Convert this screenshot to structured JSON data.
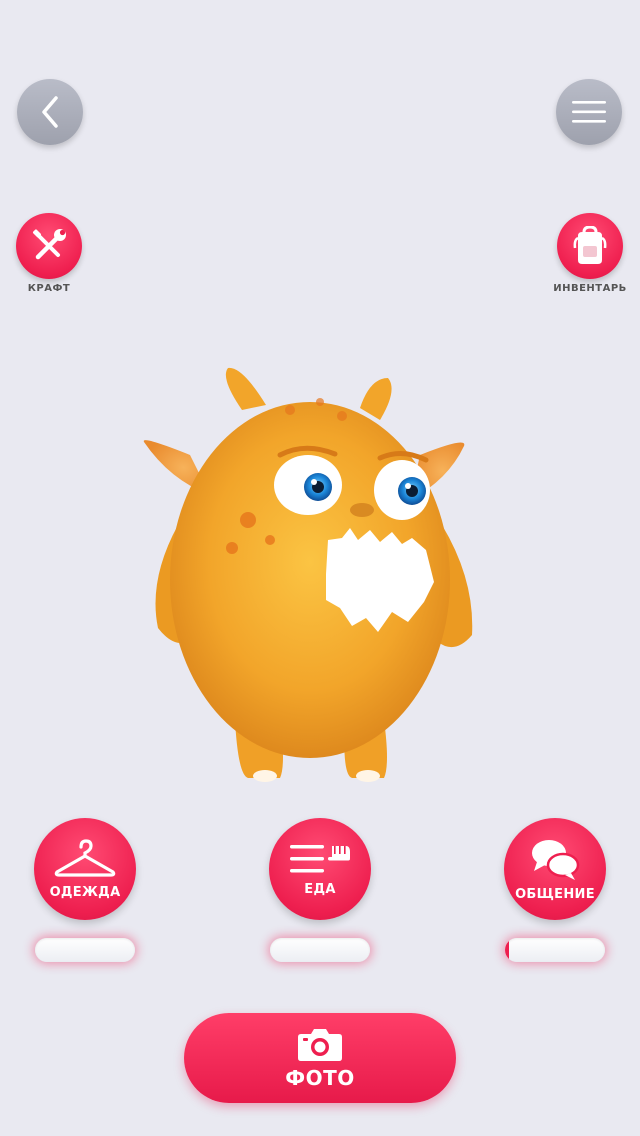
{
  "nav": {
    "back_icon": "chevron-left-icon",
    "menu_icon": "hamburger-menu-icon"
  },
  "side_actions": {
    "craft": {
      "label": "КРАФТ",
      "icon": "wrench-screwdriver-icon"
    },
    "inventory": {
      "label": "ИНВЕНТАРЬ",
      "icon": "backpack-icon"
    }
  },
  "needs": [
    {
      "label": "ОДЕЖДА",
      "icon": "hanger-icon",
      "level": 0
    },
    {
      "label": "ЕДА",
      "icon": "fork-icon",
      "level": 0
    },
    {
      "label": "ОБЩЕНИЕ",
      "icon": "chat-bubbles-icon",
      "level": 0.04
    }
  ],
  "photo_button": {
    "label": "ФОТО",
    "icon": "camera-icon"
  },
  "colors": {
    "accent": "#ee1f4f",
    "background": "#e9e9f1",
    "nav_button": "#a9acb8",
    "monster_body": "#f2a92c"
  }
}
